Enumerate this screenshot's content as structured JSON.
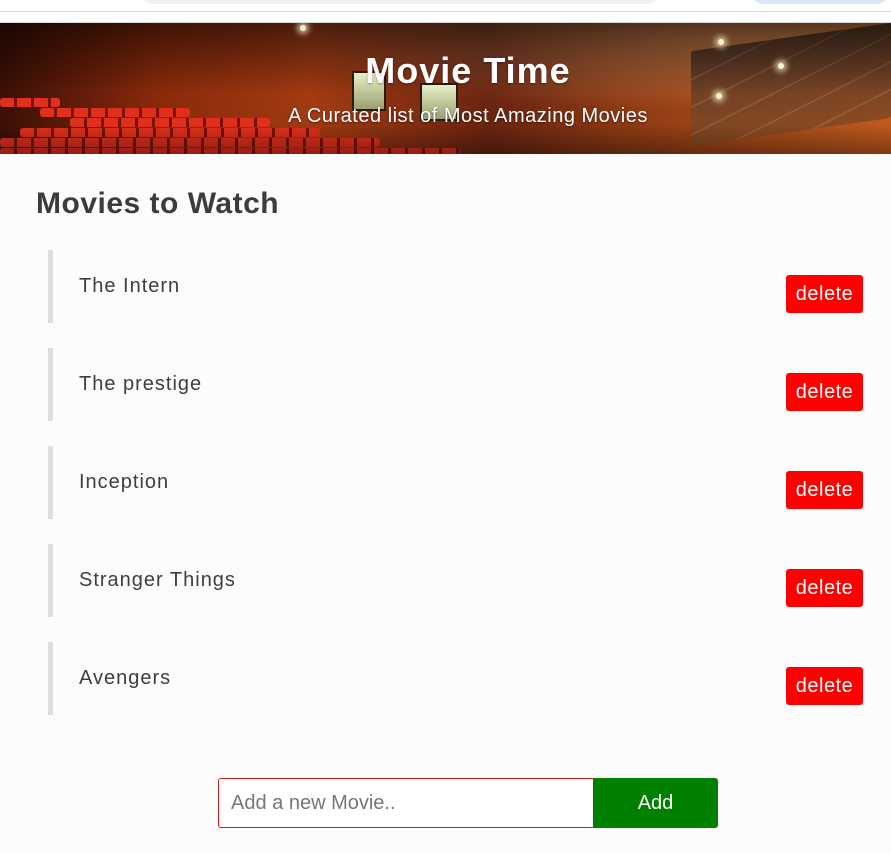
{
  "header": {
    "title": "Movie Time",
    "subtitle": "A Curated list of Most Amazing Movies"
  },
  "main": {
    "heading": "Movies to Watch",
    "movies": [
      {
        "title": "The Intern",
        "delete_label": "delete"
      },
      {
        "title": "The prestige",
        "delete_label": "delete"
      },
      {
        "title": "Inception",
        "delete_label": "delete"
      },
      {
        "title": "Stranger Things",
        "delete_label": "delete"
      },
      {
        "title": "Avengers",
        "delete_label": "delete"
      }
    ]
  },
  "add_form": {
    "placeholder": "Add a new Movie..",
    "value": "",
    "add_label": "Add"
  },
  "colors": {
    "delete_button": "#ff0000",
    "add_button": "#008000",
    "input_border": "#d11a1a",
    "list_accent": "#dedede"
  }
}
